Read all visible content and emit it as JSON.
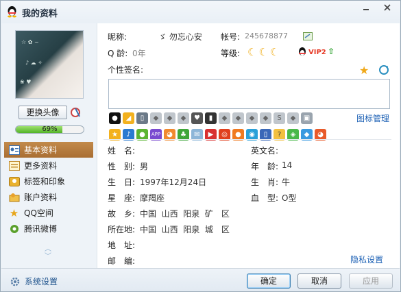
{
  "window": {
    "title": "我的资料"
  },
  "profile": {
    "nickname_label": "昵称:",
    "nickname_value": "ゞ 勿忘心安",
    "account_label": "帐号:",
    "account_value": "245678877",
    "qage_label": "Q 龄:",
    "qage_value": "0年",
    "level_label": "等级:",
    "vip_text": "VIP2",
    "signature_label": "个性签名:",
    "signature_value": "",
    "icon_manage_label": "图标管理"
  },
  "left": {
    "change_avatar_label": "更换头像",
    "progress_text": "69%",
    "progress_value": 0.69,
    "nav": [
      {
        "label": "基本资料",
        "icon": "profile-card-icon",
        "active": true
      },
      {
        "label": "更多资料",
        "icon": "more-info-icon",
        "active": false
      },
      {
        "label": "标签和印象",
        "icon": "tag-icon",
        "active": false
      },
      {
        "label": "账户资料",
        "icon": "account-icon",
        "active": false
      },
      {
        "label": "QQ空间",
        "icon": "star-icon",
        "active": false
      },
      {
        "label": "腾讯微博",
        "icon": "weibo-icon",
        "active": false
      }
    ]
  },
  "details": {
    "name_label": "姓　名:",
    "name_value": "",
    "english_name_label": "英文名:",
    "english_name_value": "",
    "gender_label": "性　别:",
    "gender_value": "男",
    "age_label": "年　龄:",
    "age_value": "14",
    "birthday_label": "生　日:",
    "birthday_value": "1997年12月24日",
    "zodiac_label": "生　肖:",
    "zodiac_value": "牛",
    "constellation_label": "星　座:",
    "constellation_value": "摩羯座",
    "blood_label": "血　型:",
    "blood_value": "O型",
    "hometown_label": "故　乡:",
    "hometown_value": "中国  山西  阳泉  矿　区",
    "location_label": "所在地:",
    "location_value": "中国  山西  阳泉  城　区",
    "address_label": "地　址:",
    "address_value": "",
    "postcode_label": "邮　编:",
    "postcode_value": "",
    "privacy_label": "隐私设置"
  },
  "bottom": {
    "system_settings_label": "系统设置",
    "ok_label": "确定",
    "cancel_label": "取消",
    "apply_label": "应用"
  },
  "colors": {
    "accent_blue": "#1a5fb4",
    "nav_active": "#b07538",
    "progress_green": "#52b427"
  }
}
